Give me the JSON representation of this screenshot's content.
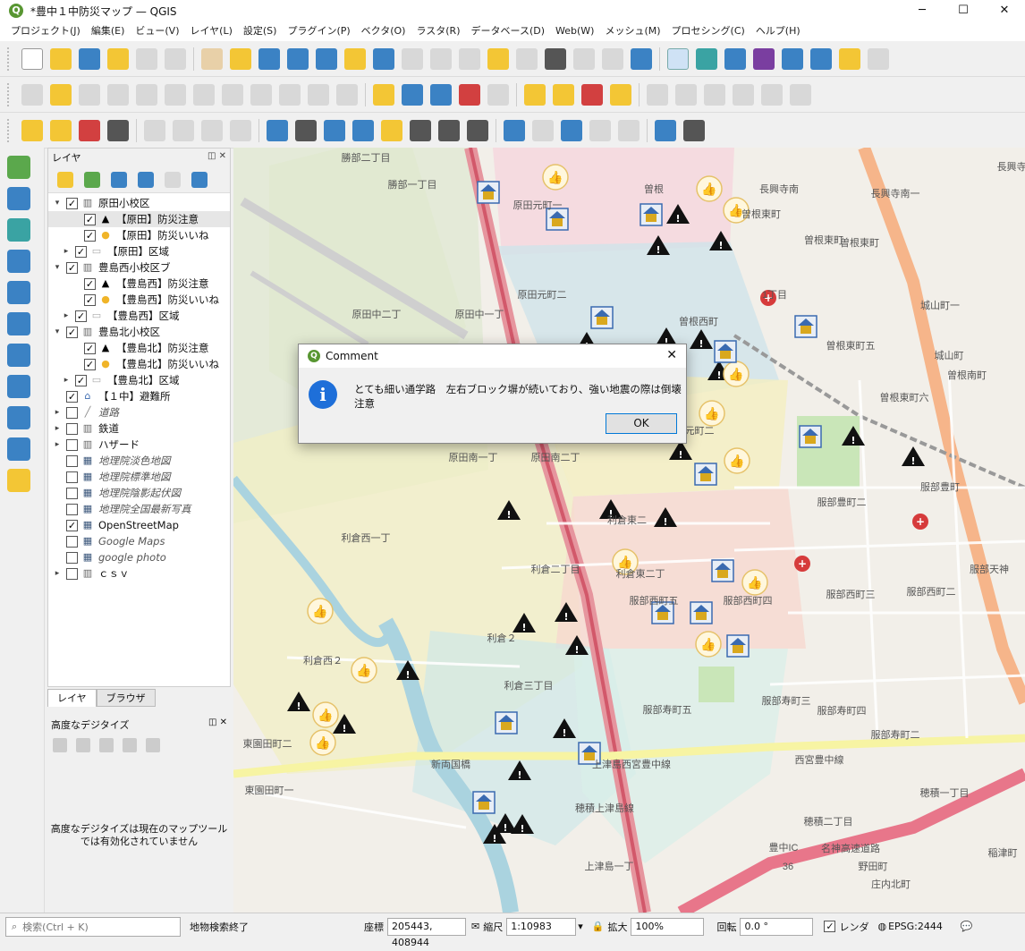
{
  "window": {
    "title": "*豊中１中防災マップ — QGIS"
  },
  "menu": [
    "プロジェクト(J)",
    "編集(E)",
    "ビュー(V)",
    "レイヤ(L)",
    "設定(S)",
    "プラグイン(P)",
    "ベクタ(O)",
    "ラスタ(R)",
    "データベース(D)",
    "Web(W)",
    "メッシュ(M)",
    "プロセシング(C)",
    "ヘルプ(H)"
  ],
  "layers_panel": {
    "title": "レイヤ",
    "rows": [
      {
        "label": "原田小校区",
        "indent": 0,
        "arrow": "▾",
        "checked": true,
        "icon": "group-icon",
        "glyph": "▥",
        "italic": false
      },
      {
        "label": "【原田】防災注意",
        "indent": 2,
        "arrow": "",
        "checked": true,
        "icon": "warning-icon",
        "glyph": "▲",
        "italic": false,
        "selected": true
      },
      {
        "label": "【原田】防災いいね",
        "indent": 2,
        "arrow": "",
        "checked": true,
        "icon": "thumbs-up-icon",
        "glyph": "●",
        "italic": false
      },
      {
        "label": "【原田】区域",
        "indent": 1,
        "arrow": "▸",
        "checked": true,
        "icon": "polygon-icon",
        "glyph": "▭",
        "italic": false
      },
      {
        "label": "豊島西小校区ブ",
        "indent": 0,
        "arrow": "▾",
        "checked": true,
        "icon": "group-icon",
        "glyph": "▥",
        "italic": false
      },
      {
        "label": "【豊島西】防災注意",
        "indent": 2,
        "arrow": "",
        "checked": true,
        "icon": "warning-icon",
        "glyph": "▲",
        "italic": false
      },
      {
        "label": "【豊島西】防災いいね",
        "indent": 2,
        "arrow": "",
        "checked": true,
        "icon": "thumbs-up-icon",
        "glyph": "●",
        "italic": false
      },
      {
        "label": "【豊島西】区域",
        "indent": 1,
        "arrow": "▸",
        "checked": true,
        "icon": "polygon-icon",
        "glyph": "▭",
        "italic": false
      },
      {
        "label": "豊島北小校区",
        "indent": 0,
        "arrow": "▾",
        "checked": true,
        "icon": "group-icon",
        "glyph": "▥",
        "italic": false
      },
      {
        "label": "【豊島北】防災注意",
        "indent": 2,
        "arrow": "",
        "checked": true,
        "icon": "warning-icon",
        "glyph": "▲",
        "italic": false
      },
      {
        "label": "【豊島北】防災いいね",
        "indent": 2,
        "arrow": "",
        "checked": true,
        "icon": "thumbs-up-icon",
        "glyph": "●",
        "italic": false
      },
      {
        "label": "【豊島北】区域",
        "indent": 1,
        "arrow": "▸",
        "checked": true,
        "icon": "polygon-icon",
        "glyph": "▭",
        "italic": false
      },
      {
        "label": "【１中】避難所",
        "indent": 0,
        "arrow": "",
        "checked": true,
        "icon": "shelter-icon",
        "glyph": "⌂",
        "italic": false
      },
      {
        "label": "道路",
        "indent": 0,
        "arrow": "▸",
        "checked": false,
        "icon": "line-icon",
        "glyph": "╱",
        "italic": true
      },
      {
        "label": "鉄道",
        "indent": 0,
        "arrow": "▸",
        "checked": false,
        "icon": "group-icon",
        "glyph": "▥",
        "italic": false
      },
      {
        "label": "ハザード",
        "indent": 0,
        "arrow": "▸",
        "checked": false,
        "icon": "group-icon",
        "glyph": "▥",
        "italic": false
      },
      {
        "label": "地理院淡色地図",
        "indent": 0,
        "arrow": "",
        "checked": false,
        "icon": "raster-icon",
        "glyph": "▦",
        "italic": true
      },
      {
        "label": "地理院標準地図",
        "indent": 0,
        "arrow": "",
        "checked": false,
        "icon": "raster-icon",
        "glyph": "▦",
        "italic": true
      },
      {
        "label": "地理院陰影起伏図",
        "indent": 0,
        "arrow": "",
        "checked": false,
        "icon": "raster-icon",
        "glyph": "▦",
        "italic": true
      },
      {
        "label": "地理院全国最新写真",
        "indent": 0,
        "arrow": "",
        "checked": false,
        "icon": "raster-icon",
        "glyph": "▦",
        "italic": true
      },
      {
        "label": "OpenStreetMap",
        "indent": 0,
        "arrow": "",
        "checked": true,
        "icon": "raster-icon",
        "glyph": "▦",
        "italic": false
      },
      {
        "label": "Google Maps",
        "indent": 0,
        "arrow": "",
        "checked": false,
        "icon": "raster-icon",
        "glyph": "▦",
        "italic": true
      },
      {
        "label": "google photo",
        "indent": 0,
        "arrow": "",
        "checked": false,
        "icon": "raster-icon",
        "glyph": "▦",
        "italic": true
      },
      {
        "label": "ｃｓｖ",
        "indent": 0,
        "arrow": "▸",
        "checked": false,
        "icon": "group-icon",
        "glyph": "▥",
        "italic": false
      }
    ]
  },
  "tabs": [
    "レイヤ",
    "ブラウザ"
  ],
  "digitize_panel": {
    "title": "高度なデジタイズ",
    "message": "高度なデジタイズは現在のマップツールでは有効化されていません"
  },
  "dialog": {
    "title": "Comment",
    "message": "とても細い通学路　左右ブロック塀が続いており、強い地震の際は倒壊注意",
    "ok_label": "OK"
  },
  "status": {
    "search_placeholder": "検索(Ctrl + K)",
    "message": "地物検索終了",
    "coord_label": "座標",
    "coord_value": "205443, 408944",
    "scale_label": "縮尺",
    "scale_value": "1:10983",
    "magnifier_label": "拡大",
    "magnifier_value": "100%",
    "rotation_label": "回転",
    "rotation_value": "0.0 °",
    "render_label": "レンダ",
    "crs": "EPSG:2444"
  },
  "map_labels": [
    "勝部二丁目",
    "勝部一丁目",
    "原田元町一",
    "曽根",
    "曽根東町",
    "曽根東町",
    "1丁目",
    "長興寺南一",
    "長興寺南",
    "長興寺",
    "曽根東町",
    "城山町一",
    "原田中二丁",
    "原田中一丁",
    "曽根西町",
    "原田元町二",
    "曽根東町五",
    "城山町",
    "曽根東町六",
    "曽根南町",
    "原田元町二",
    "原田南一丁",
    "原田南二丁",
    "服部豊町",
    "服部豊町二",
    "利倉東二",
    "利倉西一丁",
    "利倉二丁目",
    "利倉東二丁",
    "服部西町五",
    "服部西町三",
    "服部西町二",
    "服部天神",
    "利倉２",
    "利倉西２",
    "利倉三丁目",
    "服部西町四",
    "服部寿町五",
    "服部寿町四",
    "服部寿町三",
    "服部寿町二",
    "東園田町二",
    "新両国橋",
    "上津島西宮豊中線",
    "西宮豊中線",
    "東園田町一",
    "穂積上津島線",
    "穂積一丁目",
    "穂積二丁目",
    "名神高速道路",
    "豊中IC",
    "36",
    "上津島一丁",
    "野田町",
    "庄内北町",
    "稲津町"
  ]
}
